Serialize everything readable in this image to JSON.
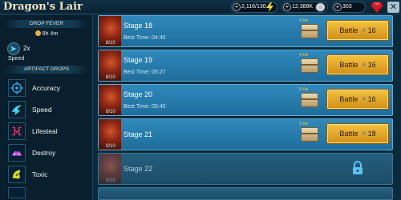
{
  "header": {
    "title": "Dragon's Lair",
    "energy": "2,116/130",
    "silver": "12,389K",
    "gems": "303",
    "colors": {
      "bar": "#0a2232",
      "energy_icon": "#f2d235",
      "gem_icon": "#c81e2a"
    }
  },
  "sidebar": {
    "drop_fever_title": "DROP FEVER",
    "timer": "8h 4m",
    "boost_multiplier": "2x",
    "boost_label": "Speed",
    "artifact_drops_title": "ARTIFACT DROPS",
    "artifacts": [
      {
        "label": "Accuracy",
        "icon": "accuracy-icon"
      },
      {
        "label": "Speed",
        "icon": "speed-icon"
      },
      {
        "label": "Lifesteal",
        "icon": "lifesteal-icon"
      },
      {
        "label": "Destroy",
        "icon": "destroy-icon"
      },
      {
        "label": "Toxic",
        "icon": "toxic-icon"
      }
    ]
  },
  "stages": [
    {
      "name": "Stage 18",
      "best_time_label": "Best Time:",
      "best_time": "04:40",
      "energy": "8/10",
      "battle_label": "Battle",
      "energy_cost": "16",
      "chest_stars": "4-5★",
      "locked": false
    },
    {
      "name": "Stage 19",
      "best_time_label": "Best Time:",
      "best_time": "05:27",
      "energy": "8/10",
      "battle_label": "Battle",
      "energy_cost": "16",
      "chest_stars": "4-5★",
      "locked": false
    },
    {
      "name": "Stage 20",
      "best_time_label": "Best Time:",
      "best_time": "05:40",
      "energy": "8/10",
      "battle_label": "Battle",
      "energy_cost": "16",
      "chest_stars": "5-6★",
      "locked": false
    },
    {
      "name": "Stage 21",
      "energy": "0/10",
      "battle_label": "Battle",
      "energy_cost": "18",
      "chest_stars": "5-6★",
      "locked": false
    },
    {
      "name": "Stage 22",
      "energy": "0/10",
      "locked": true
    }
  ]
}
